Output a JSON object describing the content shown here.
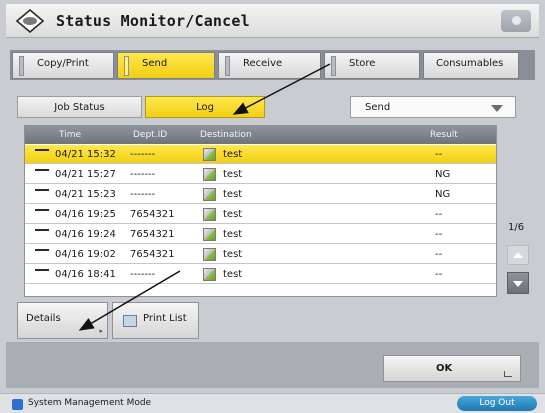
{
  "window": {
    "title": "Status Monitor/Cancel"
  },
  "tabs": [
    {
      "label": "Copy/Print"
    },
    {
      "label": "Send"
    },
    {
      "label": "Receive"
    },
    {
      "label": "Store"
    },
    {
      "label": "Consumables"
    }
  ],
  "subtabs": {
    "job_status": "Job Status",
    "log": "Log"
  },
  "filter": {
    "selected": "Send"
  },
  "table": {
    "columns": {
      "time": "Time",
      "dept": "Dept.ID",
      "destination": "Destination",
      "result": "Result"
    },
    "rows": [
      {
        "time": "04/21 15:32",
        "dept": "-------",
        "destination": "test",
        "result": "--"
      },
      {
        "time": "04/21 15:27",
        "dept": "-------",
        "destination": "test",
        "result": "NG"
      },
      {
        "time": "04/21 15:23",
        "dept": "-------",
        "destination": "test",
        "result": "NG"
      },
      {
        "time": "04/16 19:25",
        "dept": "7654321",
        "destination": "test",
        "result": "--"
      },
      {
        "time": "04/16 19:24",
        "dept": "7654321",
        "destination": "test",
        "result": "--"
      },
      {
        "time": "04/16 19:02",
        "dept": "7654321",
        "destination": "test",
        "result": "--"
      },
      {
        "time": "04/16 18:41",
        "dept": "-------",
        "destination": "test",
        "result": "--"
      }
    ]
  },
  "pager": {
    "text": "1/6"
  },
  "buttons": {
    "details": "Details",
    "print_list": "Print List",
    "ok": "OK"
  },
  "status": {
    "mode": "System Management Mode",
    "logout": "Log Out"
  }
}
